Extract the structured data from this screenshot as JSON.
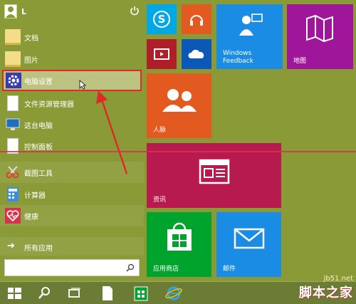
{
  "user": {
    "name": "L"
  },
  "menu": {
    "items": [
      {
        "label": "文档",
        "icon": "folder-icon"
      },
      {
        "label": "图片",
        "icon": "folder-icon"
      },
      {
        "label": "电脑设置",
        "icon": "gear-icon",
        "selected": true
      },
      {
        "label": "文件资源管理器",
        "icon": "page-icon"
      },
      {
        "label": "这台电脑",
        "icon": "monitor-icon"
      },
      {
        "label": "控制面板",
        "icon": "page-icon"
      },
      {
        "label": "截图工具",
        "icon": "scissors-icon"
      },
      {
        "label": "计算器",
        "icon": "calculator-icon"
      },
      {
        "label": "健康",
        "icon": "heart-icon"
      }
    ],
    "all_apps": "所有应用"
  },
  "tiles": {
    "windows_feedback": "Windows\nFeedback",
    "maps": "地图",
    "people": "人脉",
    "news": "资讯",
    "store": "应用商店",
    "mail": "邮件"
  },
  "watermark": {
    "line1": "jb51.net",
    "line2": "脚本之家"
  },
  "colors": {
    "background": "#8a9a36",
    "skype": "#00a9e5",
    "music": "#e25a20",
    "video": "#b01e2a",
    "onedrive": "#0b58b9",
    "feedback": "#1b8ce3",
    "maps": "#a0169b",
    "people": "#e25a20",
    "news": "#b71a4e",
    "store": "#00a42d",
    "mail": "#1b8ce3",
    "highlight_border": "#e02a2a"
  }
}
